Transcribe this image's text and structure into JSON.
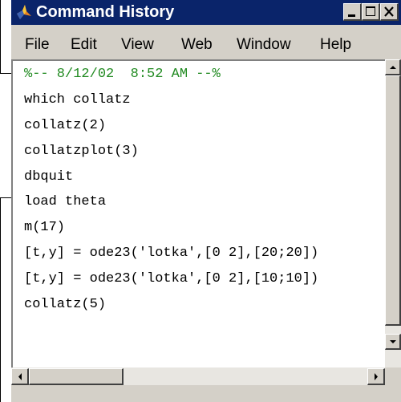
{
  "window": {
    "title": "Command History",
    "icon": "matlab-logo-icon"
  },
  "title_buttons": [
    {
      "name": "minimize-button",
      "icon": "minimize-icon"
    },
    {
      "name": "maximize-button",
      "icon": "maximize-icon"
    },
    {
      "name": "close-button",
      "icon": "close-icon"
    }
  ],
  "menu": {
    "items": [
      "File",
      "Edit",
      "View",
      "Web",
      "Window",
      "Help"
    ]
  },
  "history": {
    "session_header": "%-- 8/12/02  8:52 AM --%",
    "commands": [
      "which collatz",
      "collatz(2)",
      "collatzplot(3)",
      "dbquit",
      "load theta",
      "m(17)",
      "[t,y] = ode23('lotka',[0 2],[20;20])",
      "[t,y] = ode23('lotka',[0 2],[10;10])",
      "collatz(5)"
    ]
  },
  "colors": {
    "titlebar": "#0a246a",
    "session_header": "#228b22",
    "chrome": "#d4d0c8"
  }
}
